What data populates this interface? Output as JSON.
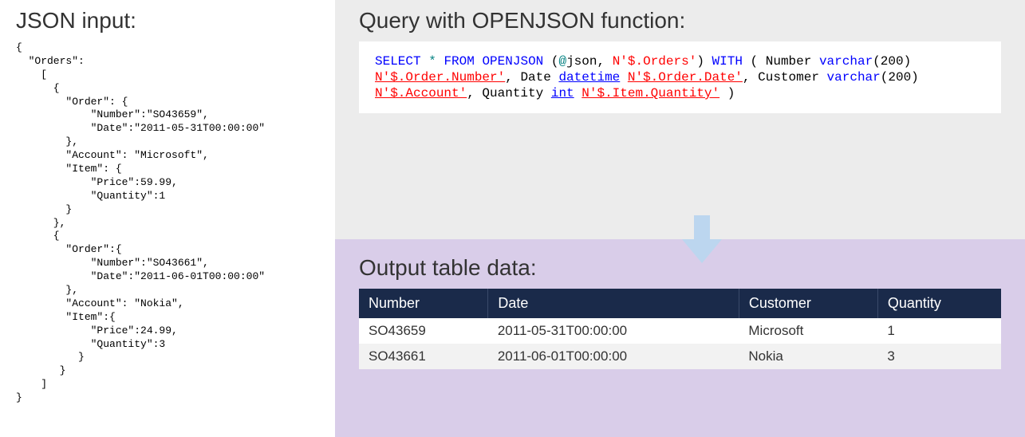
{
  "left": {
    "heading": "JSON input:",
    "json_text": "{\n  \"Orders\":\n    [\n      {\n        \"Order\": {\n            \"Number\":\"SO43659\",\n            \"Date\":\"2011-05-31T00:00:00\"\n        },\n        \"Account\": \"Microsoft\",\n        \"Item\": {\n            \"Price\":59.99,\n            \"Quantity\":1\n        }\n      },\n      {\n        \"Order\":{\n            \"Number\":\"SO43661\",\n            \"Date\":\"2011-06-01T00:00:00\"\n        },\n        \"Account\": \"Nokia\",\n        \"Item\":{\n            \"Price\":24.99,\n            \"Quantity\":3\n          }\n       }\n    ]\n}"
  },
  "query": {
    "heading": "Query with OPENJSON function:",
    "kw_select": "SELECT",
    "star": "*",
    "kw_from": "FROM",
    "kw_openjson": "OPENJSON",
    "openjson_arg1": "@json",
    "at_sign_colored": "@",
    "json_word": "json",
    "openjson_arg2": "N'$.Orders'",
    "kw_with": "WITH",
    "col1_name": "Number",
    "col1_type": "varchar",
    "col1_len": "200",
    "col1_path": "N'$.Order.Number'",
    "col2_name": "Date",
    "col2_type": "datetime",
    "col2_path": "N'$.Order.Date'",
    "col3_name": "Customer",
    "col3_type": "varchar",
    "col3_len": "200",
    "col3_path": "N'$.Account'",
    "col4_name": "Quantity",
    "col4_type": "int",
    "col4_path": "N'$.Item.Quantity'"
  },
  "output": {
    "heading": "Output table data:",
    "headers": [
      "Number",
      "Date",
      "Customer",
      "Quantity"
    ],
    "rows": [
      [
        "SO43659",
        "2011-05-31T00:00:00",
        "Microsoft",
        "1"
      ],
      [
        "SO43661",
        "2011-06-01T00:00:00",
        "Nokia",
        "3"
      ]
    ]
  }
}
